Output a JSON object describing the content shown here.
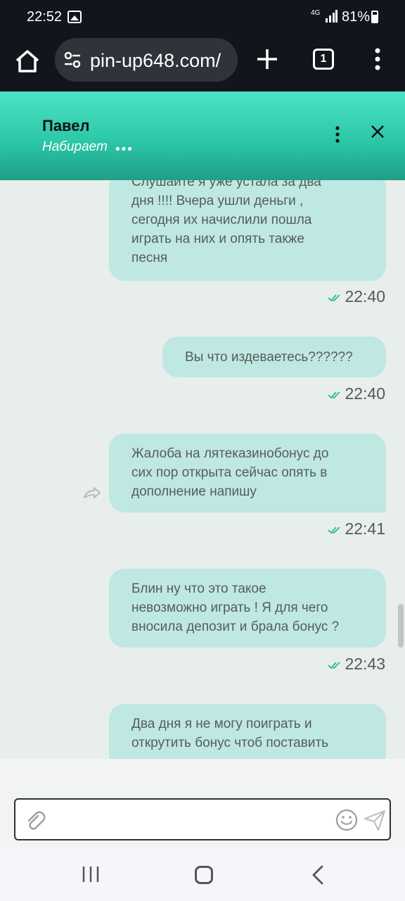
{
  "status_bar": {
    "time": "22:52",
    "network": "4G",
    "battery": "81%"
  },
  "browser": {
    "url": "pin-up648.com/",
    "tab_count": "1"
  },
  "chat_header": {
    "contact_name": "Павел",
    "status": "Набирает",
    "typing_dots": "•••"
  },
  "messages": [
    {
      "text": "Слушайте я уже устала за два\nдня !!!! Вчера ушли деньги ,\nсегодня их начислили пошла\nиграть на них и опять также\nпесня",
      "time": "22:40"
    },
    {
      "text": "Вы что издеваетесь??????",
      "time": "22:40"
    },
    {
      "text": "Жалоба на лятеказинобонус до\nсих пор открыта сейчас опять в\nдополнение напишу",
      "time": "22:41"
    },
    {
      "text": "Блин ну что это такое\nневозможно играть ! Я для чего\nвносила депозит и брала бонус ?",
      "time": "22:43"
    },
    {
      "text": "Два дня я не могу поиграть и\nоткрутить бонус чтоб поставить",
      "time": ""
    }
  ],
  "composer": {
    "placeholder": ""
  },
  "colors": {
    "header_gradient_top": "#4de3c6",
    "bubble": "#bfe8e2",
    "tick": "#2bb7a0",
    "browser_bar": "#12161c"
  }
}
